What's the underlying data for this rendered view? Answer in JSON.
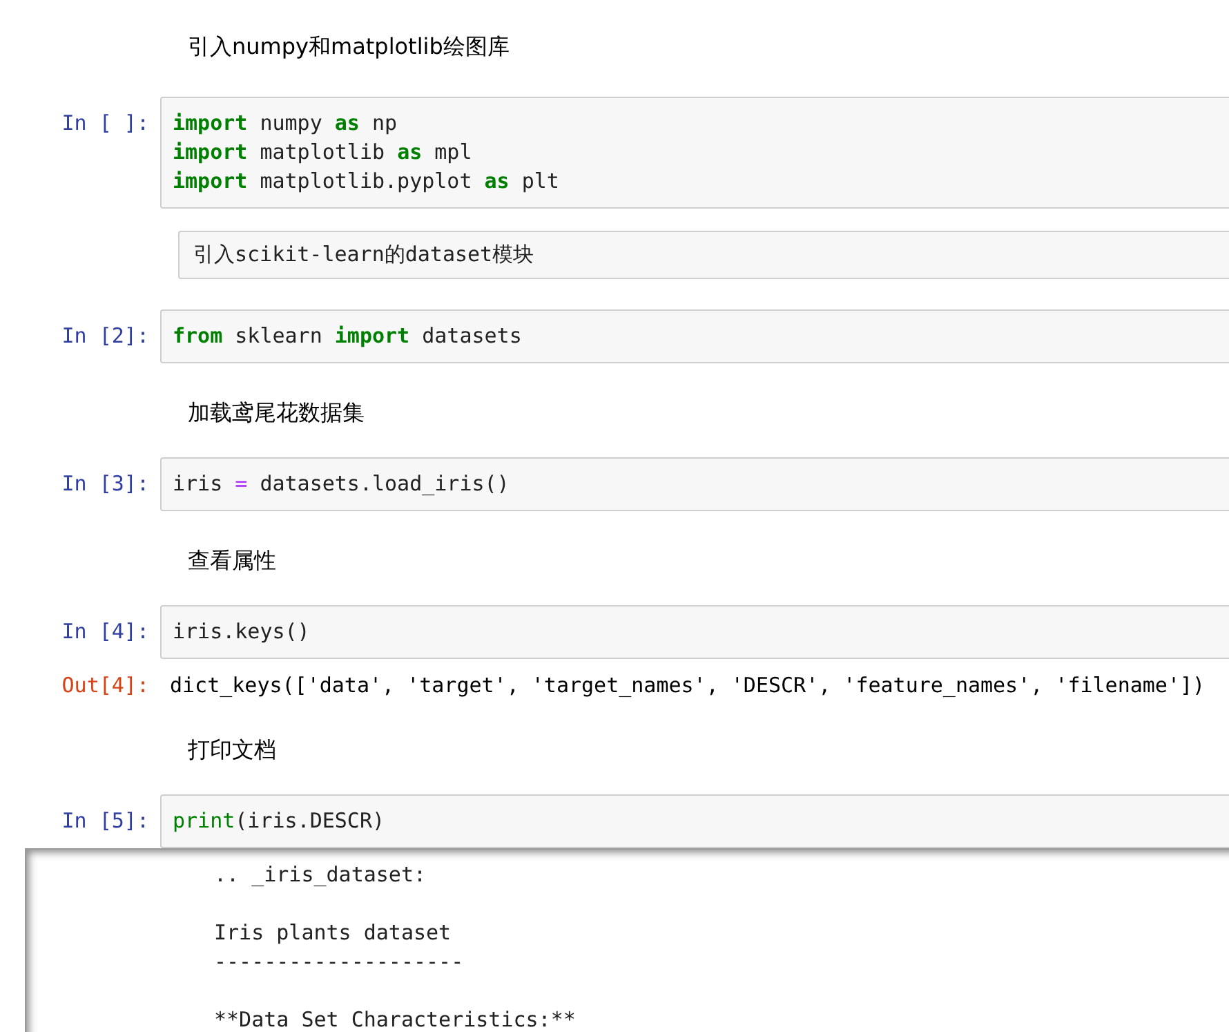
{
  "cells": [
    {
      "kind": "markdown",
      "rendered": true,
      "text": "引入numpy和matplotlib绘图库"
    },
    {
      "kind": "code",
      "prompt": "In [ ]:",
      "lines": [
        [
          {
            "kind": "keyword",
            "t": "import"
          },
          {
            "kind": "plain",
            "t": " numpy "
          },
          {
            "kind": "keyword",
            "t": "as"
          },
          {
            "kind": "plain",
            "t": " np"
          }
        ],
        [
          {
            "kind": "keyword",
            "t": "import"
          },
          {
            "kind": "plain",
            "t": " matplotlib "
          },
          {
            "kind": "keyword",
            "t": "as"
          },
          {
            "kind": "plain",
            "t": " mpl"
          }
        ],
        [
          {
            "kind": "keyword",
            "t": "import"
          },
          {
            "kind": "plain",
            "t": " matplotlib.pyplot "
          },
          {
            "kind": "keyword",
            "t": "as"
          },
          {
            "kind": "plain",
            "t": " plt"
          }
        ]
      ]
    },
    {
      "kind": "markdown",
      "rendered": false,
      "text": "引入scikit-learn的dataset模块"
    },
    {
      "kind": "code",
      "prompt": "In [2]:",
      "lines": [
        [
          {
            "kind": "keyword",
            "t": "from"
          },
          {
            "kind": "plain",
            "t": " sklearn "
          },
          {
            "kind": "keyword",
            "t": "import"
          },
          {
            "kind": "plain",
            "t": " datasets"
          }
        ]
      ]
    },
    {
      "kind": "markdown",
      "rendered": true,
      "text": "加载鸢尾花数据集"
    },
    {
      "kind": "code",
      "prompt": "In [3]:",
      "lines": [
        [
          {
            "kind": "plain",
            "t": "iris "
          },
          {
            "kind": "operator",
            "t": "="
          },
          {
            "kind": "plain",
            "t": " datasets.load_iris()"
          }
        ]
      ]
    },
    {
      "kind": "markdown",
      "rendered": true,
      "text": "查看属性"
    },
    {
      "kind": "code",
      "prompt": "In [4]:",
      "lines": [
        [
          {
            "kind": "plain",
            "t": "iris.keys()"
          }
        ]
      ]
    },
    {
      "kind": "output",
      "prompt": "Out[4]:",
      "text": "dict_keys(['data', 'target', 'target_names', 'DESCR', 'feature_names', 'filename'])"
    },
    {
      "kind": "markdown",
      "rendered": true,
      "text": "打印文档"
    },
    {
      "kind": "code",
      "prompt": "In [5]:",
      "lines": [
        [
          {
            "kind": "builtin",
            "t": "print"
          },
          {
            "kind": "plain",
            "t": "(iris.DESCR)"
          }
        ]
      ]
    },
    {
      "kind": "stream",
      "paragraphs": [
        [
          ".. _iris_dataset:"
        ],
        [
          "Iris plants dataset",
          "--------------------"
        ],
        [
          "**Data Set Characteristics:**"
        ]
      ]
    }
  ]
}
